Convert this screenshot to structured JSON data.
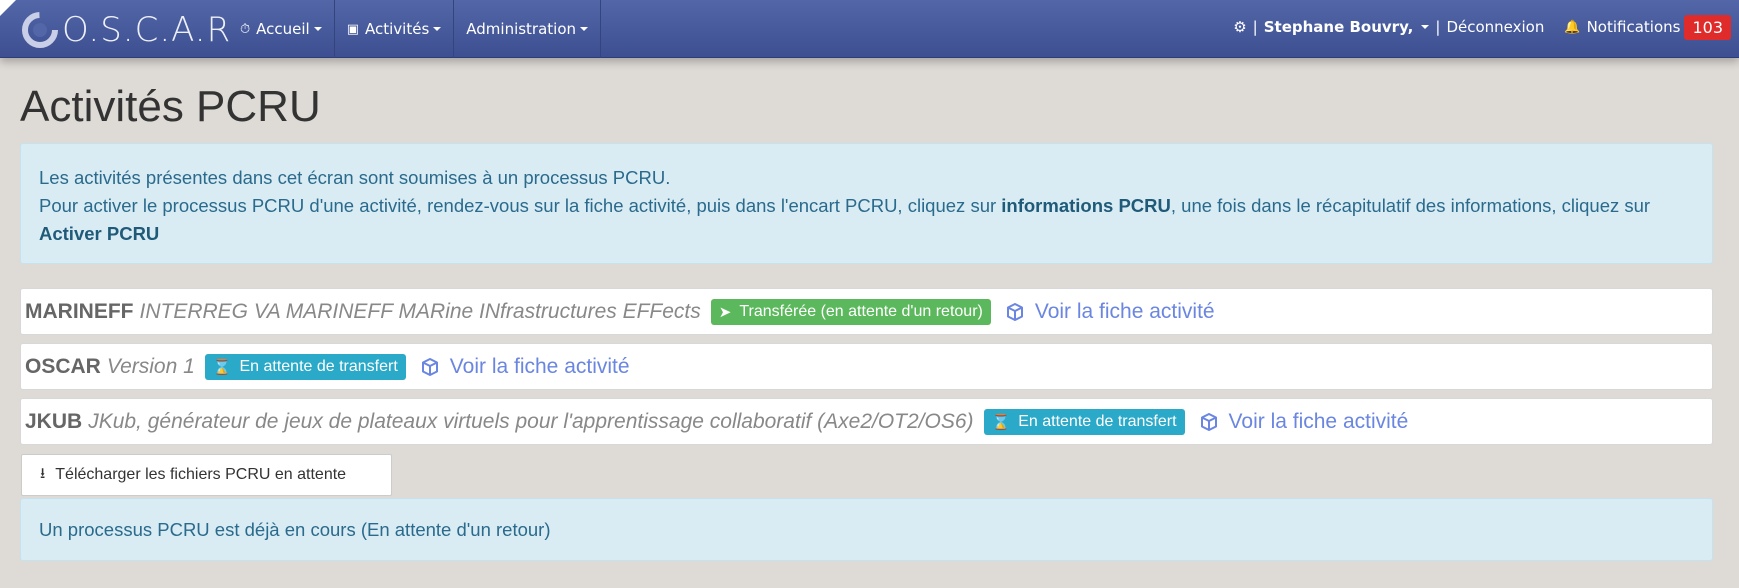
{
  "navbar": {
    "brand": "O.S.C.A.R",
    "menu": [
      {
        "label": "Accueil",
        "icon": "dashboard-icon"
      },
      {
        "label": "Activités",
        "icon": "cube-icon"
      },
      {
        "label": "Administration",
        "icon": ""
      }
    ],
    "user_name": "Stephane Bouvry,",
    "separator": "|",
    "logout": "Déconnexion",
    "notifications_label": "Notifications",
    "notifications_count": "103"
  },
  "page": {
    "title": "Activités PCRU",
    "intro_line1": "Les activités présentes dans cet écran sont soumises à un processus PCRU.",
    "intro_line2_a": "Pour activer le processus PCRU d'une activité, rendez-vous sur la fiche activité, puis dans l'encart PCRU, cliquez sur ",
    "intro_line2_bold": "informations PCRU",
    "intro_line2_b": ", une fois dans le récapitulatif des informations, cliquez sur ",
    "intro_line2_bold2": "Activer PCRU"
  },
  "activities": [
    {
      "acronym": "MARINEFF",
      "label": "INTERREG VA MARINEFF MARine INfrastructures EFFects",
      "status": "Transférée (en attente d'un retour)",
      "status_color": "#5cb85c",
      "link": "Voir la fiche activité"
    },
    {
      "acronym": "OSCAR",
      "label": "Version 1",
      "status": "En attente de transfert",
      "status_color": "#2aa9c8",
      "link": "Voir la fiche activité"
    },
    {
      "acronym": "JKUB",
      "label": "JKub, générateur de jeux de plateaux virtuels pour l'apprentissage collaboratif (Axe2/OT2/OS6)",
      "status": "En attente de transfert",
      "status_color": "#2aa9c8",
      "link": "Voir la fiche activité"
    }
  ],
  "download_button": "Télécharger les fichiers PCRU en attente",
  "process_notice": "Un processus PCRU est déjà en cours (En attente d'un retour)"
}
